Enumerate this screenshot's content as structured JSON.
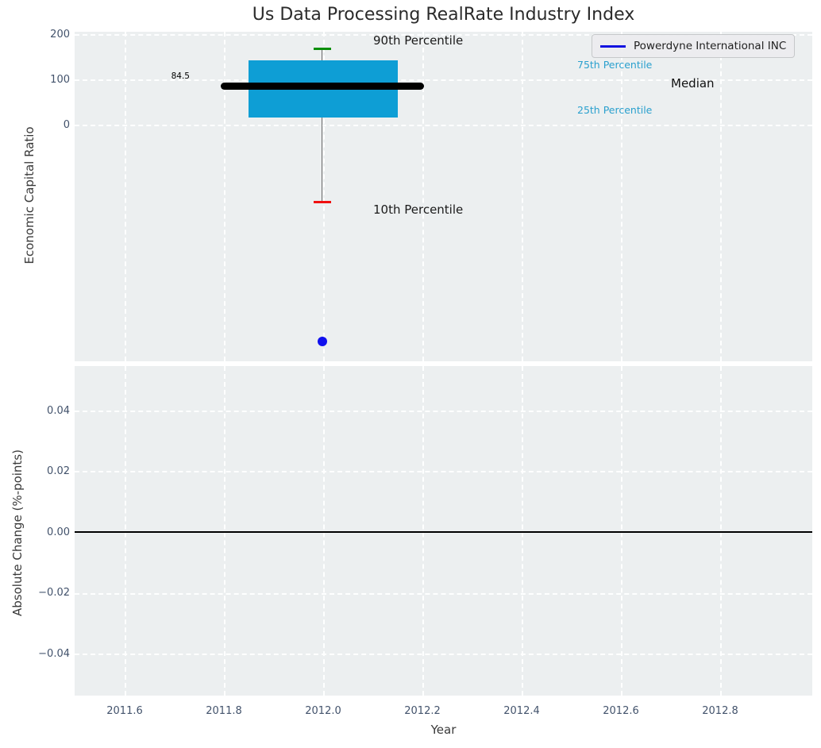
{
  "title": "Us Data Processing RealRate Industry Index",
  "top_chart": {
    "ylabel": "Economic Capital Ratio",
    "yticks": [
      "200",
      "100",
      "0"
    ],
    "median_value_label": "84.5",
    "labels": {
      "p90": "90th Percentile",
      "p75": "75th Percentile",
      "median": "Median",
      "p25": "25th Percentile",
      "p10": "10th Percentile"
    },
    "legend": {
      "series_label": "Powerdyne International INC"
    }
  },
  "bottom_chart": {
    "ylabel": "Absolute Change (%-points)",
    "yticks": [
      "0.04",
      "0.02",
      "0.00",
      "−0.02",
      "−0.04"
    ],
    "xticks": [
      "2011.6",
      "2011.8",
      "2012.0",
      "2012.2",
      "2012.4",
      "2012.6",
      "2012.8"
    ],
    "xlabel": "Year"
  },
  "colors": {
    "axes_background": "#eceff0",
    "box_fill": "#0e9ed5",
    "median_band": "#000000",
    "p90_cap": "#0a8f0a",
    "p10_cap": "#f01010",
    "company_marker": "#1010ee",
    "percentile_text": "#2aa0ce",
    "tick_text": "#42526b",
    "zero_line": "#000000"
  },
  "chart_data": [
    {
      "type": "boxplot",
      "title": "Us Data Processing RealRate Industry Index",
      "ylabel": "Economic Capital Ratio",
      "xlim": [
        2011.5,
        2013.0
      ],
      "ylim": [
        -530,
        205
      ],
      "yticks": [
        0,
        100,
        200
      ],
      "xticks": [
        2011.6,
        2011.8,
        2012.0,
        2012.2,
        2012.4,
        2012.6,
        2012.8
      ],
      "grid": true,
      "legend_position": "upper right",
      "boxes": [
        {
          "x": 2012.0,
          "p10": -170,
          "p25": 15,
          "median": 84.5,
          "p75": 143,
          "p90": 170,
          "median_label": "84.5"
        }
      ],
      "series": [
        {
          "name": "Powerdyne International INC",
          "type": "scatter",
          "color": "#1010ee",
          "points": [
            {
              "x": 2012.0,
              "y": -480
            }
          ]
        }
      ],
      "annotations": [
        {
          "text": "90th Percentile",
          "x": 2012.1,
          "y": 185
        },
        {
          "text": "75th Percentile",
          "x": 2012.51,
          "y": 128
        },
        {
          "text": "Median",
          "x": 2012.7,
          "y": 88
        },
        {
          "text": "25th Percentile",
          "x": 2012.51,
          "y": 28
        },
        {
          "text": "10th Percentile",
          "x": 2012.1,
          "y": -190
        },
        {
          "text": "84.5",
          "x": 2011.73,
          "y": 84.5
        }
      ]
    },
    {
      "type": "line",
      "ylabel": "Absolute Change (%-points)",
      "xlabel": "Year",
      "xlim": [
        2011.5,
        2013.0
      ],
      "ylim": [
        -0.055,
        0.055
      ],
      "yticks": [
        0.04,
        0.02,
        0.0,
        -0.02,
        -0.04
      ],
      "xticks": [
        2011.6,
        2011.8,
        2012.0,
        2012.2,
        2012.4,
        2012.6,
        2012.8
      ],
      "grid": true,
      "zero_line_y": 0.0,
      "series": []
    }
  ]
}
